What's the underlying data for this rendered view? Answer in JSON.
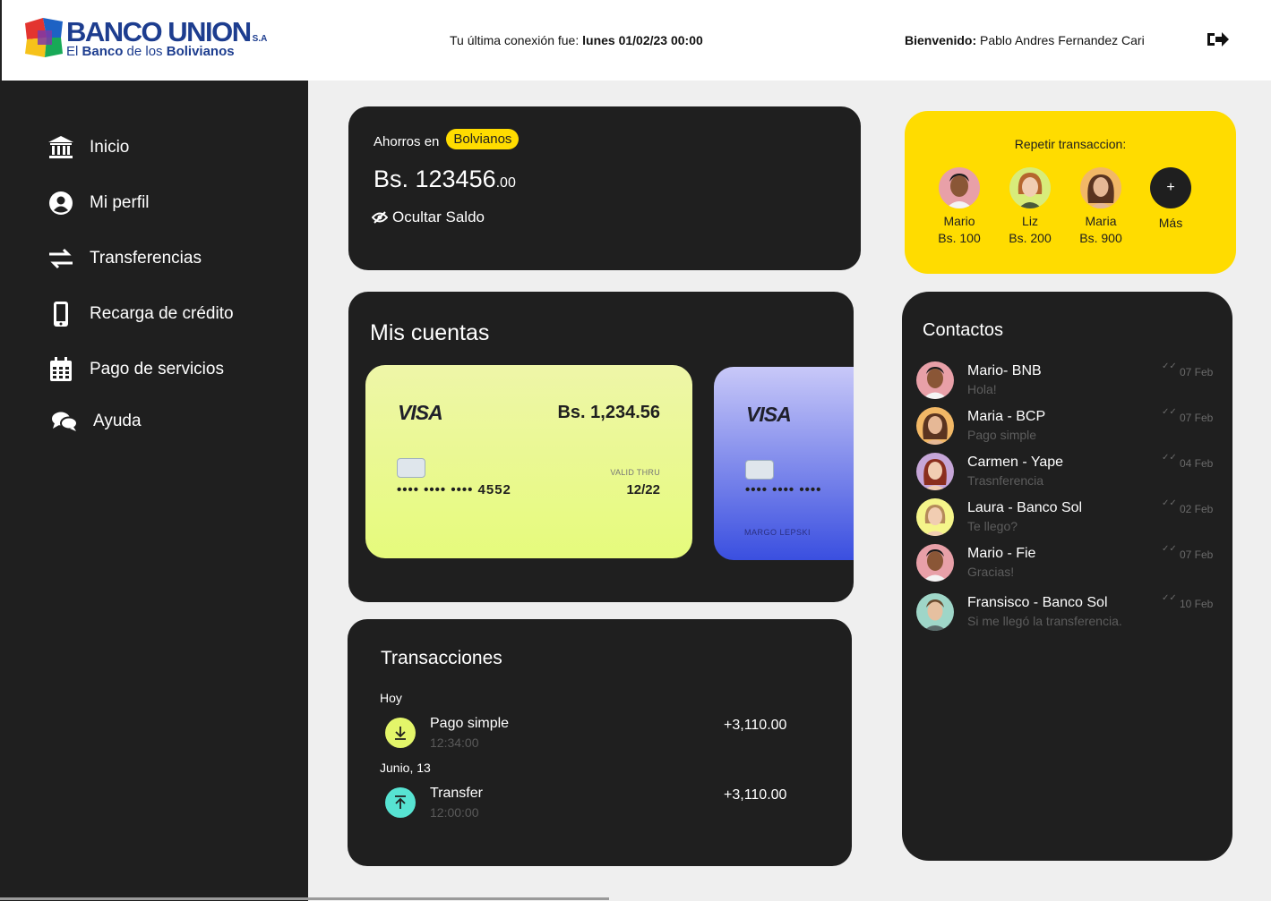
{
  "brand": {
    "name": "BANCO UNION",
    "suffix": "S.A",
    "tagline_prefix": "El ",
    "tagline_bold1": "Banco",
    "tagline_mid": " de los ",
    "tagline_bold2": "Bolivianos"
  },
  "header": {
    "last_connection_label": "Tu última conexión fue: ",
    "last_connection_value": "lunes 01/02/23 00:00",
    "welcome_label": "Bienvenido: ",
    "user_name": "Pablo Andres Fernandez Cari"
  },
  "sidebar": {
    "items": [
      {
        "label": "Inicio",
        "icon": "bank-icon"
      },
      {
        "label": "Mi perfil",
        "icon": "user-icon"
      },
      {
        "label": "Transferencias",
        "icon": "transfer-icon"
      },
      {
        "label": "Recarga de crédito",
        "icon": "phone-icon"
      },
      {
        "label": "Pago de servicios",
        "icon": "calendar-icon"
      },
      {
        "label": "Ayuda",
        "icon": "chat-icon"
      }
    ]
  },
  "savings": {
    "label": "Ahorros en",
    "currency_pill": "Bolvianos",
    "balance_main": "Bs. 123456",
    "balance_cents": ".00",
    "hide_label": "Ocultar Saldo"
  },
  "repeat": {
    "title": "Repetir transaccion:",
    "contacts": [
      {
        "name": "Mario",
        "amount": "Bs. 100"
      },
      {
        "name": "Liz",
        "amount": "Bs. 200"
      },
      {
        "name": "Maria",
        "amount": "Bs. 900"
      }
    ],
    "more_symbol": "+",
    "more_label": "Más"
  },
  "accounts": {
    "title": "Mis cuentas",
    "cards": [
      {
        "brand": "VISA",
        "amount": "Bs. 1,234.56",
        "dots": "•••• •••• ••••",
        "last4": "4552",
        "valid_label": "VALID THRU",
        "expiry": "12/22"
      },
      {
        "brand": "VISA",
        "dots": "•••• •••• ••••",
        "holder": "MARGO LEPSKI"
      }
    ]
  },
  "transactions": {
    "title": "Transacciones",
    "groups": [
      {
        "date": "Hoy",
        "items": [
          {
            "name": "Pago simple",
            "time": "12:34:00",
            "amount": "+3,110.00"
          }
        ]
      },
      {
        "date": "Junio, 13",
        "items": [
          {
            "name": "Transfer",
            "time": "12:00:00",
            "amount": "+3,110.00"
          }
        ]
      }
    ]
  },
  "contacts": {
    "title": "Contactos",
    "items": [
      {
        "name": "Mario- BNB",
        "message": "Hola!",
        "date": "07 Feb"
      },
      {
        "name": "Maria - BCP",
        "message": "Pago simple",
        "date": "07 Feb"
      },
      {
        "name": "Carmen - Yape",
        "message": "Trasnferencia",
        "date": "04 Feb"
      },
      {
        "name": "Laura - Banco Sol",
        "message": "Te llego?",
        "date": "02 Feb"
      },
      {
        "name": "Mario - Fie",
        "message": "Gracias!",
        "date": "07 Feb"
      },
      {
        "name": "Fransisco - Banco Sol",
        "message": "Si me llegó la transferencia.",
        "date": "10 Feb"
      }
    ]
  },
  "colors": {
    "accent_yellow": "#ffdc00",
    "panel_dark": "#1f1f1f",
    "brand_blue": "#1d3d8f",
    "card_lime": "#e6fb7c",
    "card_blue": "#3a4fe0",
    "download_green": "#e3f56a",
    "upload_teal": "#57e3d2"
  }
}
